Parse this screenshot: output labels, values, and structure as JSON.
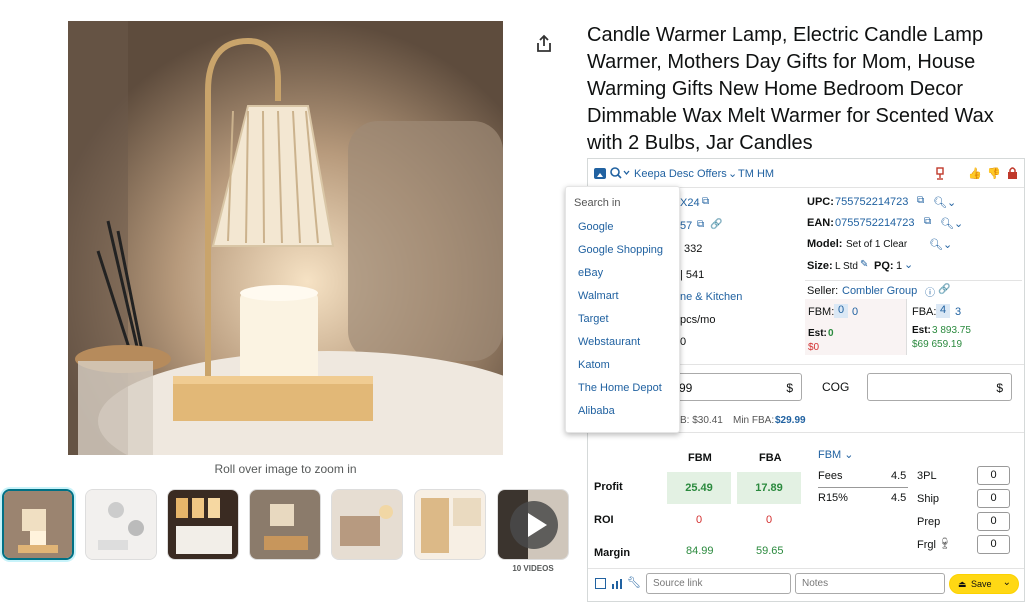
{
  "title": "Candle Warmer Lamp, Electric Candle Lamp Warmer, Mothers Day Gifts for Mom, House Warming Gifts New Home Bedroom Decor Dimmable Wax Melt Warmer for Scented Wax with 2 Bulbs, Jar Candles",
  "gallery": {
    "zoom_hint": "Roll over image to zoom in",
    "videos_label": "10 VIDEOS"
  },
  "toolbar": {
    "links": "Keepa Desc Offers",
    "tm_hm": "TM HM"
  },
  "search_menu": {
    "header": "Search in",
    "items": [
      "Google",
      "Google Shopping",
      "eBay",
      "Walmart",
      "Target",
      "Webstaurant",
      "Katom",
      "The Home Depot",
      "Alibaba"
    ]
  },
  "details": {
    "asin_tail": "X24",
    "ean_tail": "57",
    "rank": "332",
    "reviews": "| 541",
    "category": "ne & Kitchen",
    "sales": "pcs/mo",
    "zero": "0",
    "upc_label": "UPC:",
    "upc": "755752214723",
    "ean_label": "EAN:",
    "ean": "0755752214723",
    "model_label": "Model:",
    "model": "Set of 1 Clear",
    "size_label": "Size:",
    "size": "L Std",
    "pq_label": "PQ:",
    "pq": "1",
    "seller_label": "Seller:",
    "seller": "Combler Group",
    "fbm_label": "FBM:",
    "fbm_a": "0",
    "fbm_b": "0",
    "fbm_est_label": "Est:",
    "fbm_est": "0",
    "fbm_dollar": "$0",
    "fba_label": "FBA:",
    "fba_a": "4",
    "fba_b": "3",
    "fba_est_label": "Est:",
    "fba_est": "3 893.75",
    "fba_dollar": "$69 659.19"
  },
  "pricing": {
    "price_value": "99",
    "currency": "$",
    "cog_label": "COG",
    "cog_currency": "$",
    "min_line_prefix": "B: $30.41",
    "min_fba_label": "Min FBA:",
    "min_fba": "$29.99"
  },
  "profit": {
    "col_fbm": "FBM",
    "col_fba": "FBA",
    "row_profit": "Profit",
    "row_roi": "ROI",
    "row_margin": "Margin",
    "profit_fbm": "25.49",
    "profit_fba": "17.89",
    "roi_fbm": "0",
    "roi_fba": "0",
    "margin_fbm": "84.99",
    "margin_fba": "59.65",
    "fees_header": "FBM",
    "fees_label": "Fees",
    "fees_value": "4.5",
    "r15_label": "R15%",
    "r15_value": "4.5",
    "cost_3pl": "3PL",
    "cost_ship": "Ship",
    "cost_prep": "Prep",
    "cost_frgl": "Frgl",
    "val_3pl": "0",
    "val_ship": "0",
    "val_prep": "0",
    "val_frgl": "0"
  },
  "footer": {
    "source_placeholder": "Source link",
    "notes_placeholder": "Notes",
    "save_label": "Save"
  },
  "colors": {
    "link": "#2162a1",
    "save": "#ffd814",
    "green": "#2b8a3e",
    "red": "#d32f2f"
  }
}
